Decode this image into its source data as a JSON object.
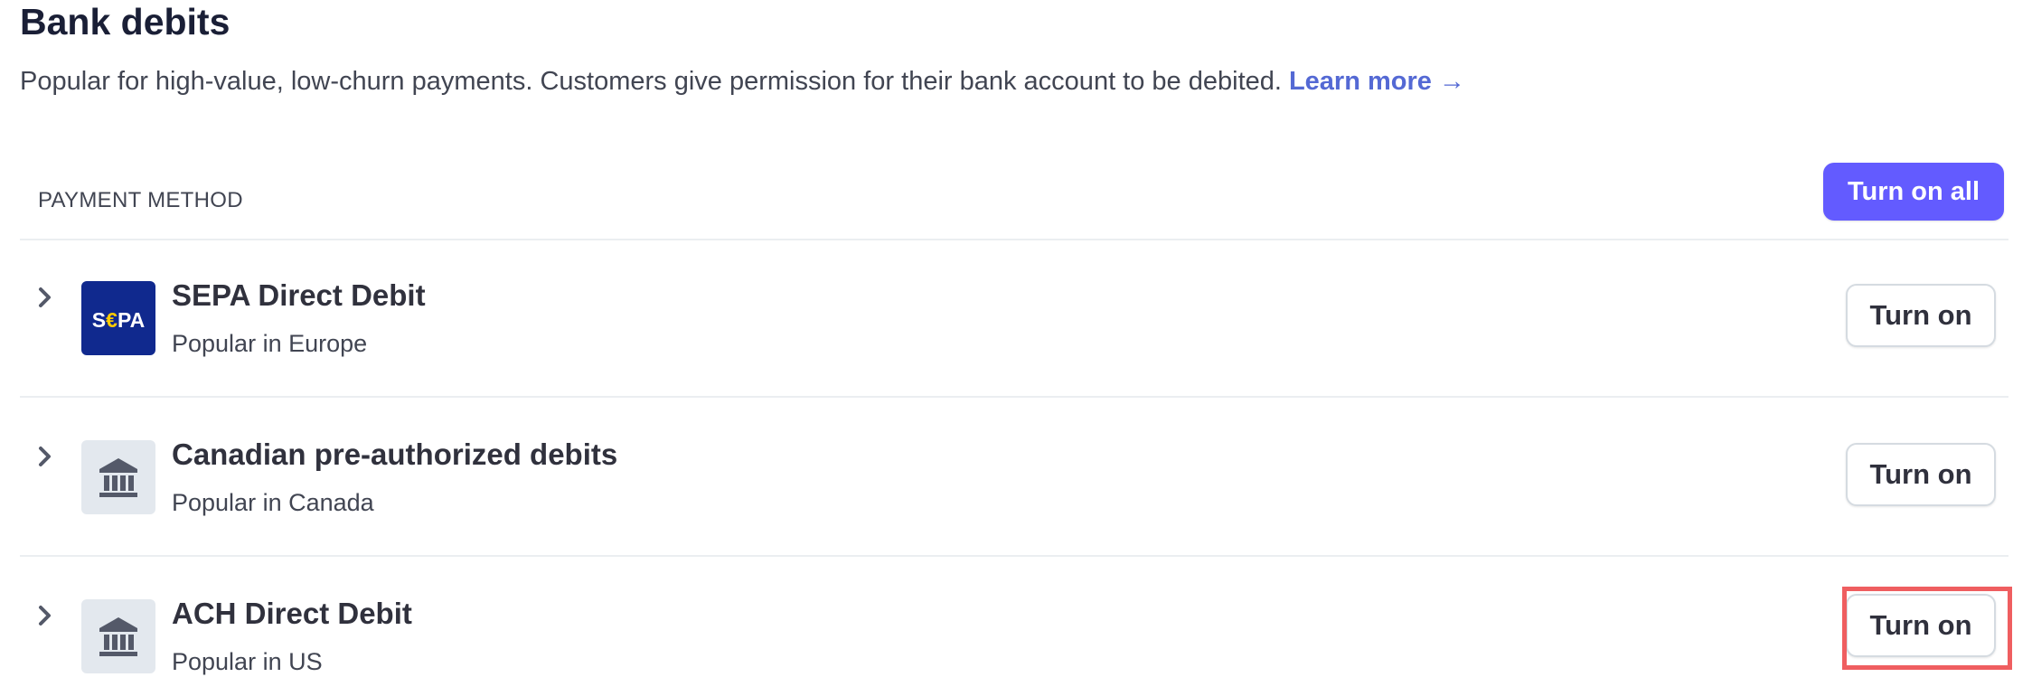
{
  "section": {
    "title": "Bank debits",
    "description": "Popular for high-value, low-churn payments. Customers give permission for their bank account to be debited.",
    "learn_more": "Learn more →"
  },
  "table": {
    "column_label": "PAYMENT METHOD",
    "turn_on_all_label": "Turn on all"
  },
  "methods": [
    {
      "name": "SEPA Direct Debit",
      "description": "Popular in Europe",
      "icon": "sepa-logo",
      "logo_text": "S€PA",
      "button_label": "Turn on"
    },
    {
      "name": "Canadian pre-authorized debits",
      "description": "Popular in Canada",
      "icon": "bank-icon",
      "button_label": "Turn on"
    },
    {
      "name": "ACH Direct Debit",
      "description": "Popular in US",
      "icon": "bank-icon",
      "button_label": "Turn on"
    }
  ],
  "colors": {
    "accent": "#635bff",
    "link": "#5469d4",
    "sepa_blue": "#10298e",
    "highlight": "#ef5e60"
  }
}
